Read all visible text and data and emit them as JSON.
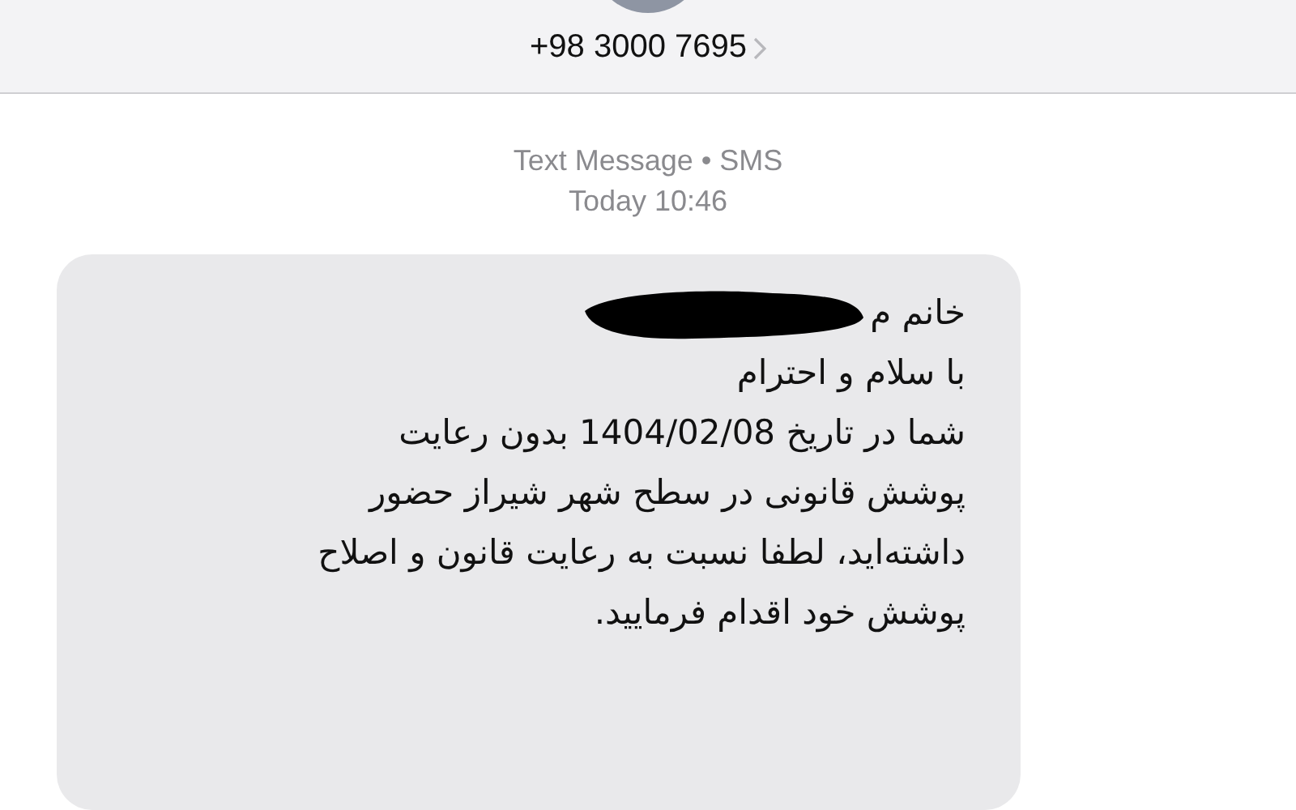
{
  "header": {
    "contact": "+98 3000 7695"
  },
  "conversation": {
    "service": "Text Message • SMS",
    "timestamp": "Today 10:46"
  },
  "message": {
    "greeting": "خانم م",
    "lines": [
      "با سلام و احترام",
      "شما در تاریخ 1404/02/08 بدون رعایت",
      "پوشش قانونی در سطح شهر شیراز حضور",
      "داشته‌اید، لطفا نسبت به رعایت قانون و اصلاح",
      "پوشش خود اقدام فرمایید."
    ]
  }
}
